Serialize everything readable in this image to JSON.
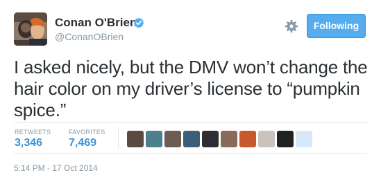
{
  "author": {
    "display_name": "Conan O'Brien",
    "handle": "@ConanOBrien",
    "verified": true,
    "avatar_icon": "avatar-photo"
  },
  "actions": {
    "settings_icon": "gear-icon",
    "follow_label": "Following"
  },
  "tweet": {
    "text": "I asked nicely, but the DMV won’t change the hair color on my driver’s license to “pumpkin spice.”"
  },
  "stats": {
    "retweets_label": "RETWEETS",
    "retweets_count": "3,346",
    "favorites_label": "FAVORITES",
    "favorites_count": "7,469"
  },
  "favoriters": [
    {
      "icon": "user-avatar",
      "color": "#5a4a44"
    },
    {
      "icon": "user-avatar",
      "color": "#4f7f8f"
    },
    {
      "icon": "user-avatar",
      "color": "#6e5b52"
    },
    {
      "icon": "user-avatar",
      "color": "#3c5e76"
    },
    {
      "icon": "user-avatar",
      "color": "#2d2d33"
    },
    {
      "icon": "user-avatar",
      "color": "#8a6a58"
    },
    {
      "icon": "user-avatar",
      "color": "#c7592e"
    },
    {
      "icon": "user-avatar",
      "color": "#c9c2bd"
    },
    {
      "icon": "user-avatar",
      "color": "#222222"
    },
    {
      "icon": "user-avatar",
      "color": "#d7e7f7"
    }
  ],
  "meta": {
    "timestamp": "5:14 PM - 17 Oct 2014"
  },
  "colors": {
    "accent": "#55acee",
    "link": "#3b94d9",
    "muted": "#8899a6",
    "text": "#292f33"
  }
}
